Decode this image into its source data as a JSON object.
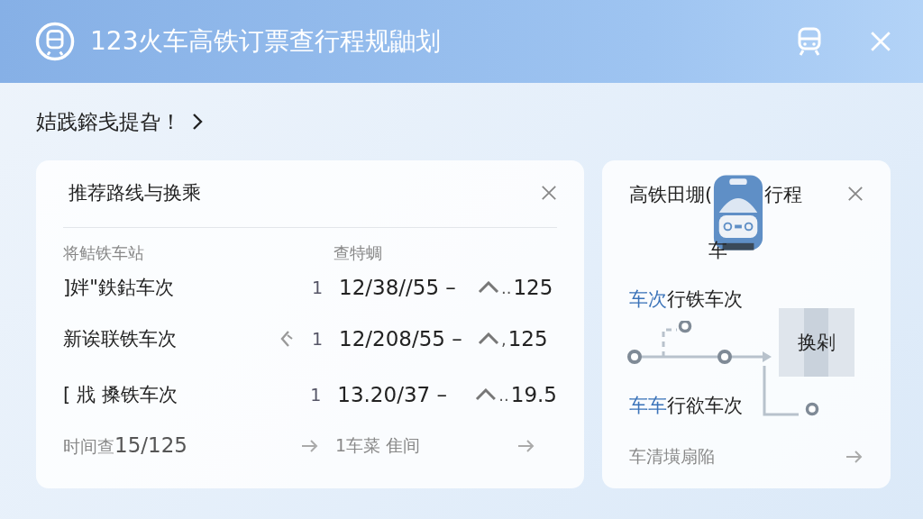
{
  "window": {
    "title": "123火车高铁订票查行程规鼬划"
  },
  "notice": {
    "text": "姞践鎔戋提旮！"
  },
  "routes_card": {
    "title": "推荐路线与换乘",
    "columns": [
      "将鲒铁车站",
      "查特蜩"
    ],
    "rows": [
      {
        "name": "]姅\"鉄鈷车次",
        "transfer": false,
        "count": "1",
        "time": "12/38//55 –",
        "sep": "..",
        "value": "125"
      },
      {
        "name": "新诶联铁车次",
        "transfer": true,
        "count": "1",
        "time": "12/208/55 –",
        "sep": ",",
        "value": "125"
      },
      {
        "name": "[ 戕 搡铁车次",
        "transfer": false,
        "count": "1",
        "time": "13.20/37 –",
        "sep": "..",
        "value": "19.5"
      }
    ],
    "footer": [
      {
        "label": "时间查",
        "value": "15/125"
      },
      {
        "label": "1车菜 隹间"
      }
    ]
  },
  "trip_card": {
    "title_start": "高铁田堋(",
    "title_end": "行程",
    "badge": "车",
    "lines": [
      {
        "highlight": "车次",
        "text": "行铁车次"
      },
      {
        "highlight": "车车",
        "text": "行欲车次"
      }
    ],
    "map_label": "换剁",
    "footer": "车清墴扇陥"
  }
}
